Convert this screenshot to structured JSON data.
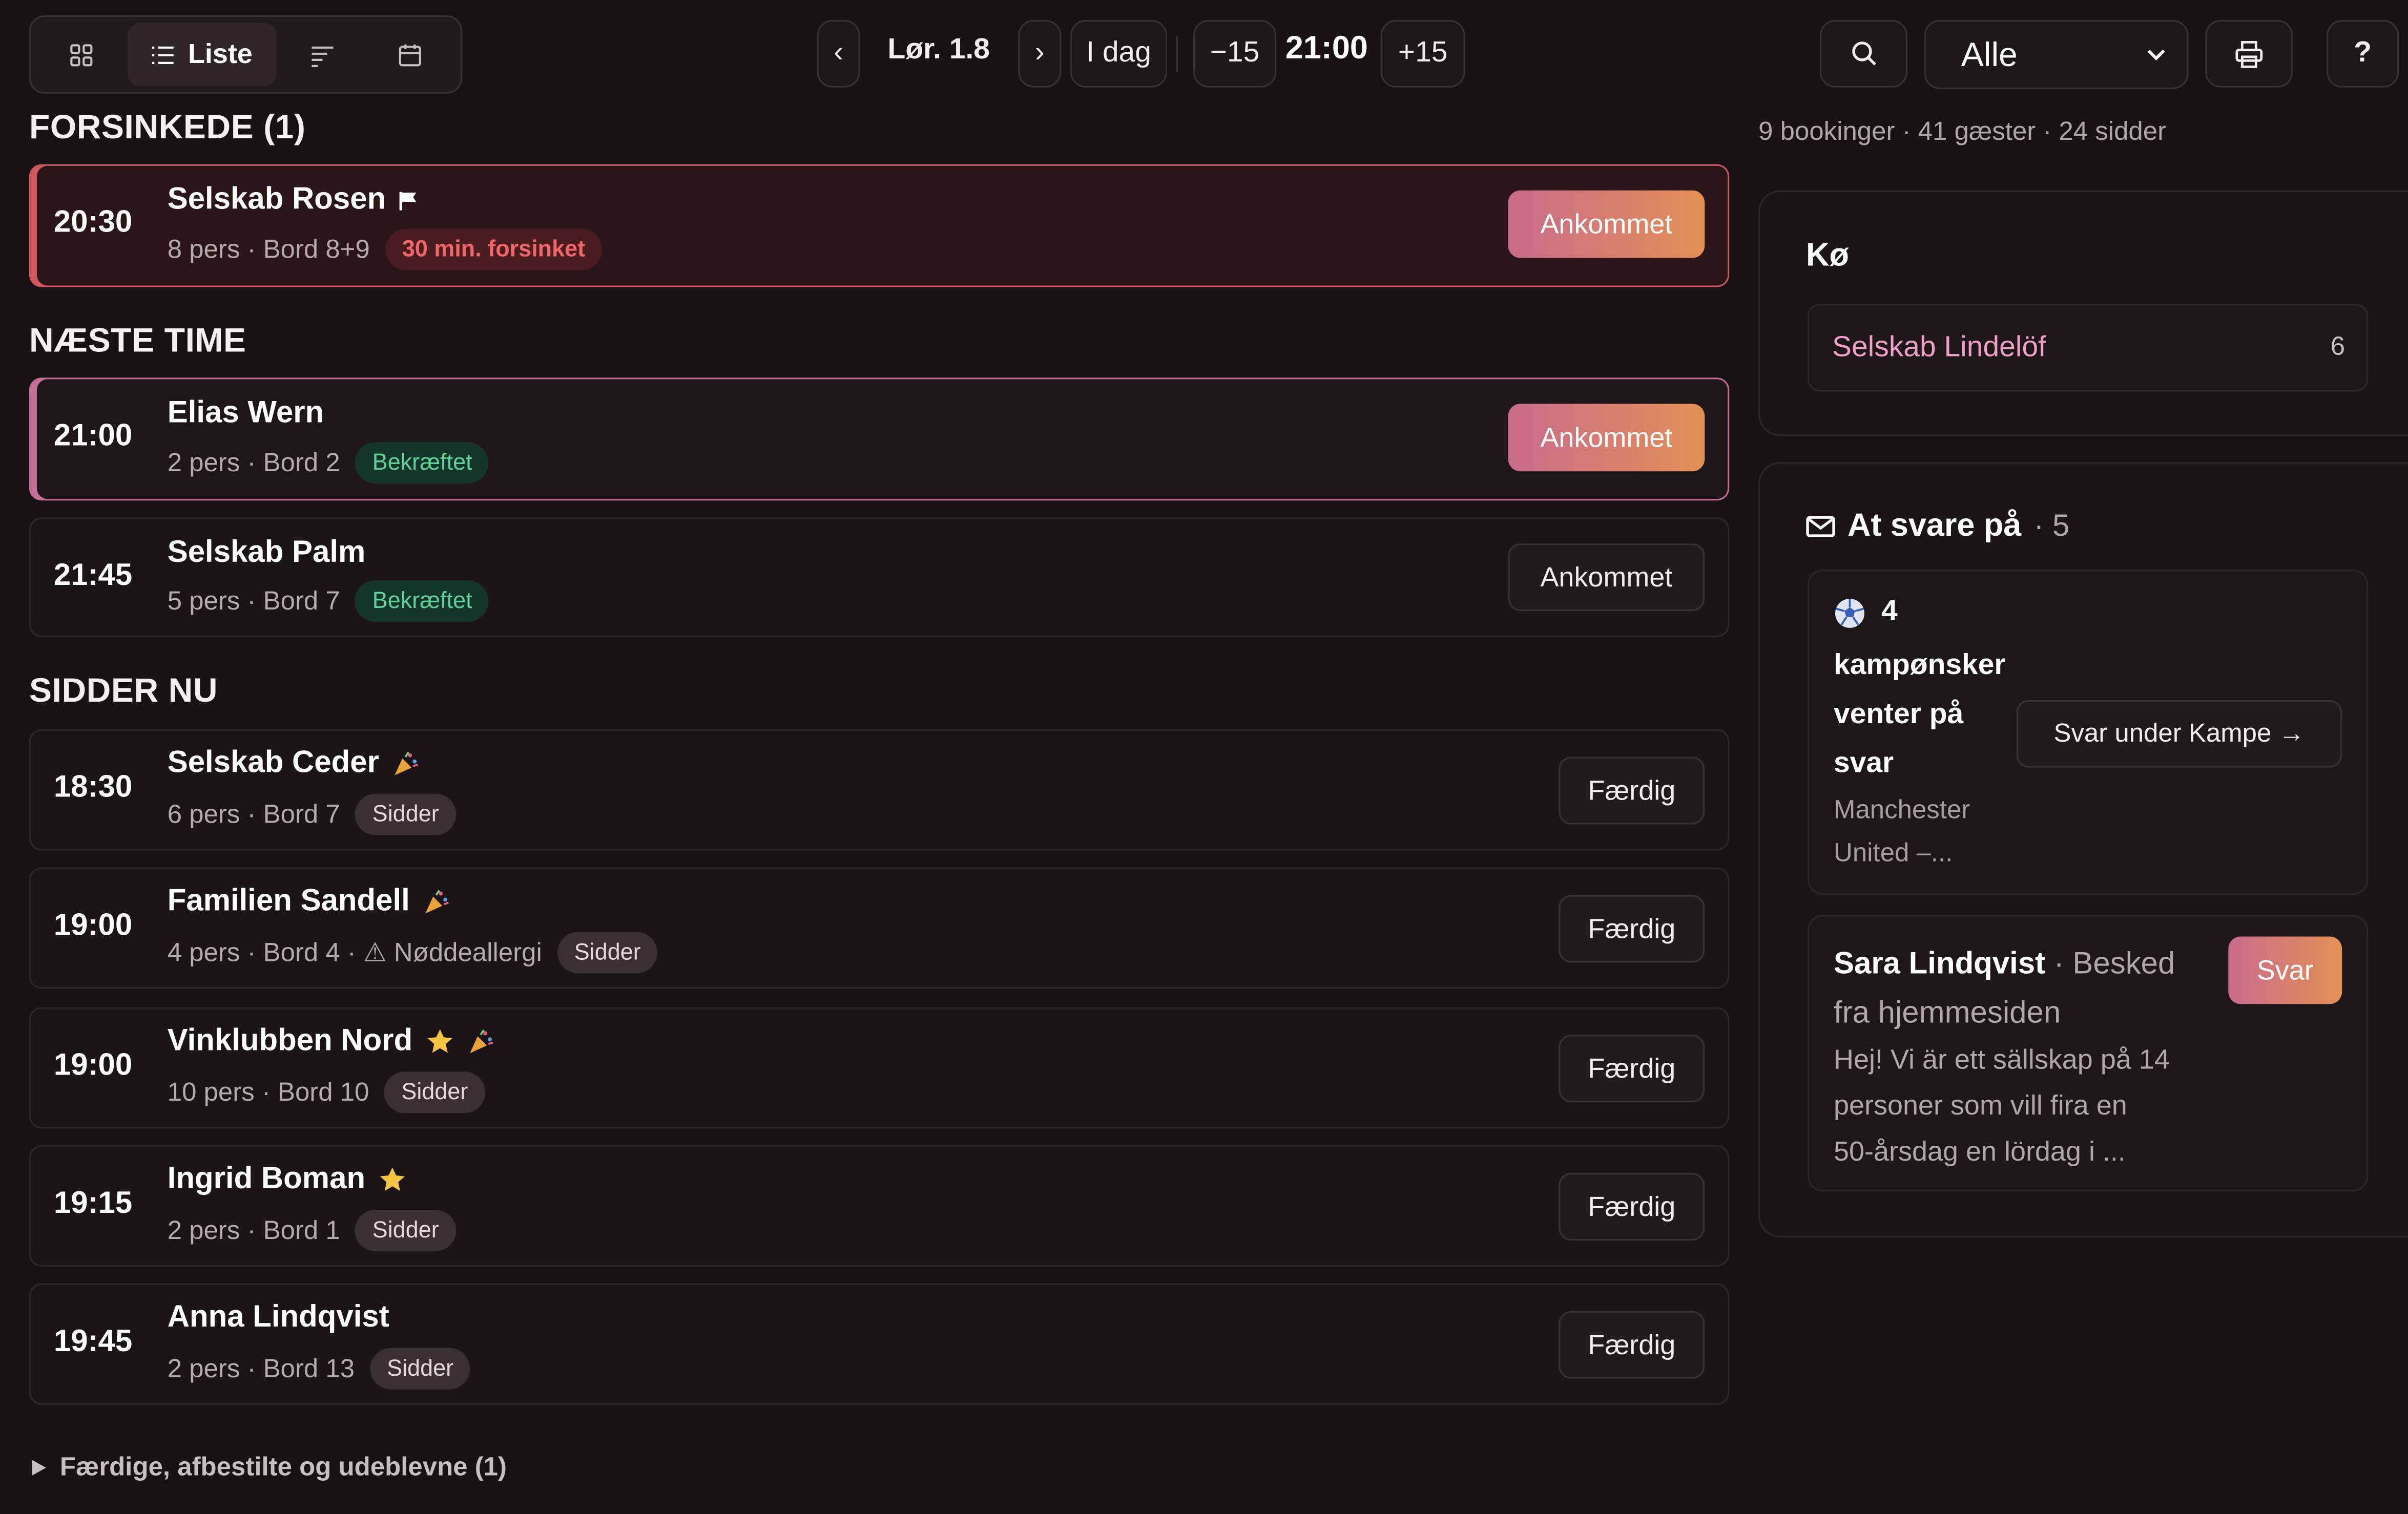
{
  "toolbar": {
    "view_tabs": [
      {
        "label": "",
        "icon": "grid-icon"
      },
      {
        "label": "Liste",
        "icon": "list-icon"
      },
      {
        "label": "",
        "icon": "timeline-icon"
      },
      {
        "label": "",
        "icon": "calendar-icon"
      }
    ],
    "date_label": "Lør. 1.8",
    "prev_label": "‹",
    "next_label": "›",
    "today_label": "I dag",
    "minus_label": "−15",
    "time_label": "21:00",
    "plus_label": "+15",
    "filter_value": "Alle",
    "help_label": "?"
  },
  "sections": {
    "late": "FORSINKEDE (1)",
    "next_hour": "NÆSTE TIME",
    "seated": "SIDDER NU"
  },
  "bookings": {
    "late": [
      {
        "time": "20:30",
        "name": "Selskab Rosen",
        "meta": "8 pers · Bord 8+9",
        "badge": "30 min. forsinket",
        "action": "Ankommet"
      }
    ],
    "next": [
      {
        "time": "21:00",
        "name": "Elias Wern",
        "meta": "2 pers · Bord 2",
        "badge": "Bekræftet",
        "action": "Ankommet"
      },
      {
        "time": "21:45",
        "name": "Selskab Palm",
        "meta": "5 pers · Bord 7",
        "badge": "Bekræftet",
        "action": "Ankommet"
      }
    ],
    "seated": [
      {
        "time": "18:30",
        "name": "Selskab Ceder",
        "meta": "6 pers · Bord 7",
        "badge": "Sidder",
        "action": "Færdig"
      },
      {
        "time": "19:00",
        "name": "Familien Sandell",
        "meta": "4 pers · Bord 4 · ⚠ Nøddeallergi",
        "badge": "Sidder",
        "action": "Færdig"
      },
      {
        "time": "19:00",
        "name": "Vinklubben Nord",
        "meta": "10 pers · Bord 10",
        "badge": "Sidder",
        "action": "Færdig"
      },
      {
        "time": "19:15",
        "name": "Ingrid Boman",
        "meta": "2 pers · Bord 1",
        "badge": "Sidder",
        "action": "Færdig"
      },
      {
        "time": "19:45",
        "name": "Anna Lindqvist",
        "meta": "2 pers · Bord 13",
        "badge": "Sidder",
        "action": "Færdig"
      }
    ]
  },
  "footer_toggle": "Færdige, afbestilte og udeblevne (1)",
  "summary": "9 bookinger · 41 gæster · 24 sidder",
  "queue": {
    "title": "Kø",
    "items": [
      {
        "name": "Selskab Lindelöf",
        "count": "6"
      }
    ]
  },
  "inbox": {
    "title": "At svare på",
    "count": "· 5",
    "match_card": {
      "count": "4",
      "text_lines": [
        "kampønsker",
        "venter på",
        "svar"
      ],
      "sub_lines": [
        "Manchester",
        "United –..."
      ],
      "button": "Svar under Kampe →"
    },
    "message_card": {
      "sender": "Sara Lindqvist",
      "source_lines": [
        "· Besked",
        "fra hjemmesiden"
      ],
      "body_lines": [
        "Hej! Vi är ett sällskap på 14",
        "personer som vill fira en",
        "50-årsdag en lördag i ..."
      ],
      "button": "Svar"
    }
  },
  "colors": {
    "background": "#181214",
    "accent_gradient_start": "#c86b8c",
    "accent_gradient_end": "#e39055",
    "late_red": "#d0585e",
    "next_pink": "#c4709a",
    "confirmed_green": "#5fd39b"
  }
}
